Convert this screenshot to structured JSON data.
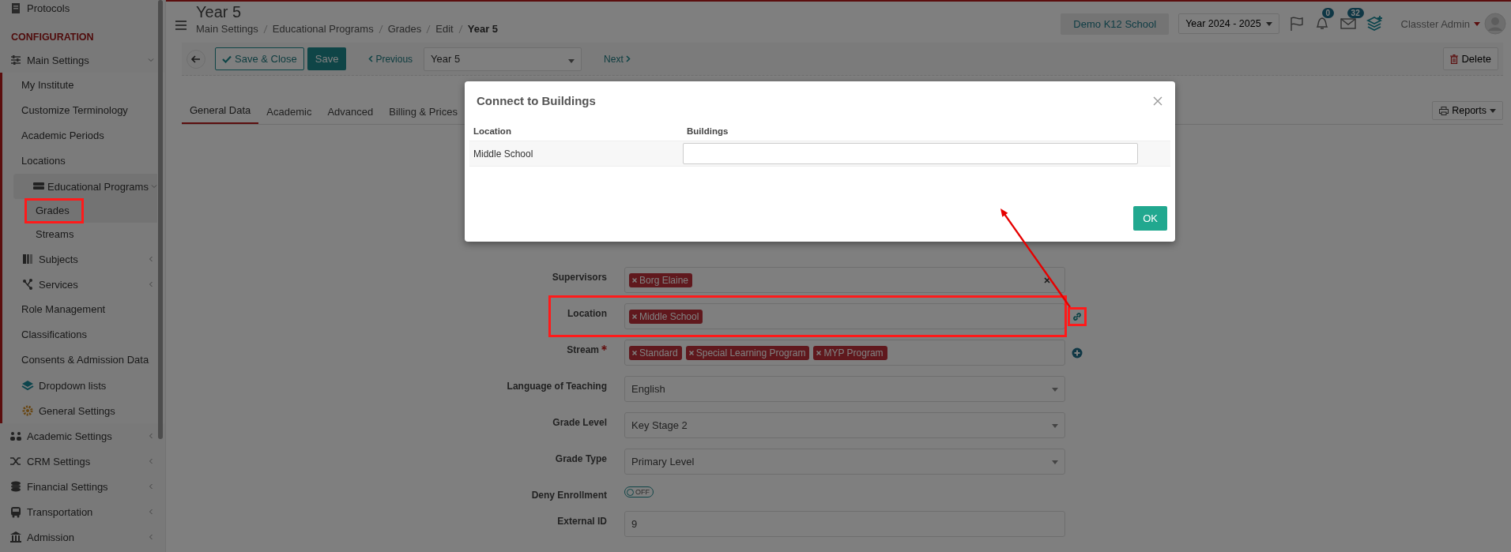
{
  "sidebar": {
    "items": [
      {
        "label": "Protocols",
        "kind": "item"
      },
      {
        "label": "CONFIGURATION",
        "kind": "section"
      },
      {
        "label": "Main Settings",
        "kind": "item",
        "expanded": true,
        "children": [
          {
            "label": "My Institute",
            "kind": "link",
            "selected": false,
            "highlighted": false
          },
          {
            "label": "Customize Terminology",
            "kind": "link",
            "selected": false,
            "highlighted": false
          },
          {
            "label": "Academic Periods",
            "kind": "link",
            "selected": false,
            "highlighted": false
          },
          {
            "label": "Locations",
            "kind": "link",
            "selected": false,
            "highlighted": false
          },
          {
            "label": "Educational Programs",
            "kind": "item",
            "expanded": true,
            "children": [
              {
                "label": "Grades",
                "kind": "link",
                "selected": true,
                "highlighted": true
              },
              {
                "label": "Streams",
                "kind": "link",
                "selected": false,
                "highlighted": false
              }
            ]
          },
          {
            "label": "Subjects",
            "kind": "item",
            "expanded": false
          },
          {
            "label": "Services",
            "kind": "item",
            "expanded": false
          },
          {
            "label": "Role Management",
            "kind": "link",
            "selected": false,
            "highlighted": false
          },
          {
            "label": "Classifications",
            "kind": "link",
            "selected": false,
            "highlighted": false
          },
          {
            "label": "Consents & Admission Data",
            "kind": "link",
            "selected": false,
            "highlighted": false
          },
          {
            "label": "Dropdown lists",
            "kind": "item"
          },
          {
            "label": "General Settings",
            "kind": "item"
          }
        ]
      },
      {
        "label": "Academic Settings",
        "kind": "item",
        "expanded": false
      },
      {
        "label": "CRM Settings",
        "kind": "item",
        "expanded": false
      },
      {
        "label": "Financial Settings",
        "kind": "item",
        "expanded": false
      },
      {
        "label": "Transportation",
        "kind": "item",
        "expanded": false
      },
      {
        "label": "Admission",
        "kind": "item",
        "expanded": false
      }
    ]
  },
  "header": {
    "title": "Year 5",
    "breadcrumb": [
      "Main Settings",
      "Educational Programs",
      "Grades",
      "Edit",
      "Year 5"
    ],
    "school": "Demo K12 School",
    "year": "Year 2024 - 2025",
    "notifications": "0",
    "messages": "32",
    "user": "Classter Admin"
  },
  "toolbar": {
    "save_close": "Save & Close",
    "save": "Save",
    "previous": "Previous",
    "record": "Year 5",
    "next": "Next",
    "delete": "Delete"
  },
  "tabs": [
    {
      "label": "General Data",
      "selected": true
    },
    {
      "label": "Academic",
      "selected": false
    },
    {
      "label": "Advanced",
      "selected": false
    },
    {
      "label": "Billing & Prices",
      "selected": false
    }
  ],
  "reports": "Reports",
  "form": [
    {
      "label": "Supervisors",
      "kind": "tags",
      "required": false,
      "highlighted": false,
      "tags": [
        "Borg Elaine"
      ],
      "clearable": true,
      "link_button": false,
      "add_button": false
    },
    {
      "label": "Location",
      "kind": "tags",
      "required": false,
      "highlighted": true,
      "tags": [
        "Middle School"
      ],
      "clearable": false,
      "link_button": true,
      "add_button": false
    },
    {
      "label": "Stream",
      "kind": "tags",
      "required": true,
      "highlighted": false,
      "tags": [
        "Standard",
        "Special Learning Program",
        "MYP Program"
      ],
      "clearable": false,
      "link_button": false,
      "add_button": true
    },
    {
      "label": "Language of Teaching",
      "kind": "select",
      "required": false,
      "highlighted": false,
      "value": "English"
    },
    {
      "label": "Grade Level",
      "kind": "select",
      "required": false,
      "highlighted": false,
      "value": "Key Stage 2"
    },
    {
      "label": "Grade Type",
      "kind": "select",
      "required": false,
      "highlighted": false,
      "value": "Primary Level"
    },
    {
      "label": "Deny Enrollment",
      "kind": "toggle",
      "required": false,
      "highlighted": false,
      "on": false,
      "text": "OFF"
    },
    {
      "label": "External ID",
      "kind": "text",
      "required": false,
      "highlighted": false,
      "value": "9"
    }
  ],
  "dialog": {
    "title": "Connect to Buildings",
    "columns": [
      "Location",
      "Buildings"
    ],
    "rows": [
      {
        "location": "Middle School",
        "buildings": ""
      }
    ],
    "ok": "OK"
  }
}
